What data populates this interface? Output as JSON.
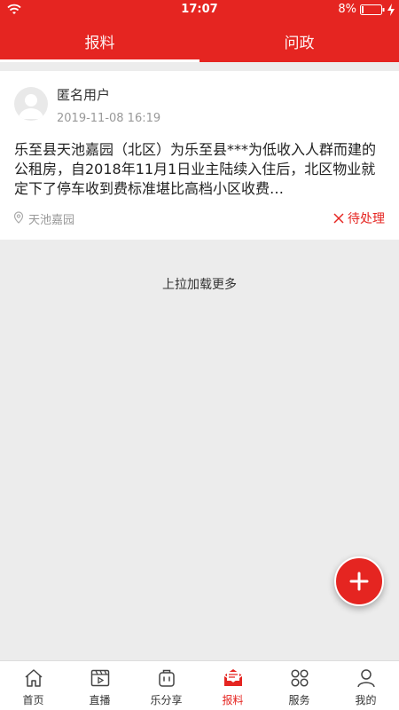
{
  "status_bar": {
    "time": "17:07",
    "battery": "8%"
  },
  "tabs": [
    {
      "label": "报料",
      "active": true
    },
    {
      "label": "问政",
      "active": false
    }
  ],
  "post": {
    "user": "匿名用户",
    "time": "2019-11-08 16:19",
    "content": "乐至县天池嘉园（北区）为乐至县***为低收入人群而建的公租房，自2018年11月1日业主陆续入住后，北区物业就定下了停车收到费标准堪比高档小区收费…",
    "location": "天池嘉园",
    "status": "待处理"
  },
  "load_more": "上拉加载更多",
  "bottom_nav": [
    {
      "label": "首页",
      "icon": "home-icon"
    },
    {
      "label": "直播",
      "icon": "video-icon"
    },
    {
      "label": "乐分享",
      "icon": "share-bag-icon"
    },
    {
      "label": "报料",
      "icon": "mail-report-icon",
      "active": true
    },
    {
      "label": "服务",
      "icon": "grid-icon"
    },
    {
      "label": "我的",
      "icon": "user-icon"
    }
  ],
  "colors": {
    "accent": "#e52521",
    "background": "#ececec"
  }
}
